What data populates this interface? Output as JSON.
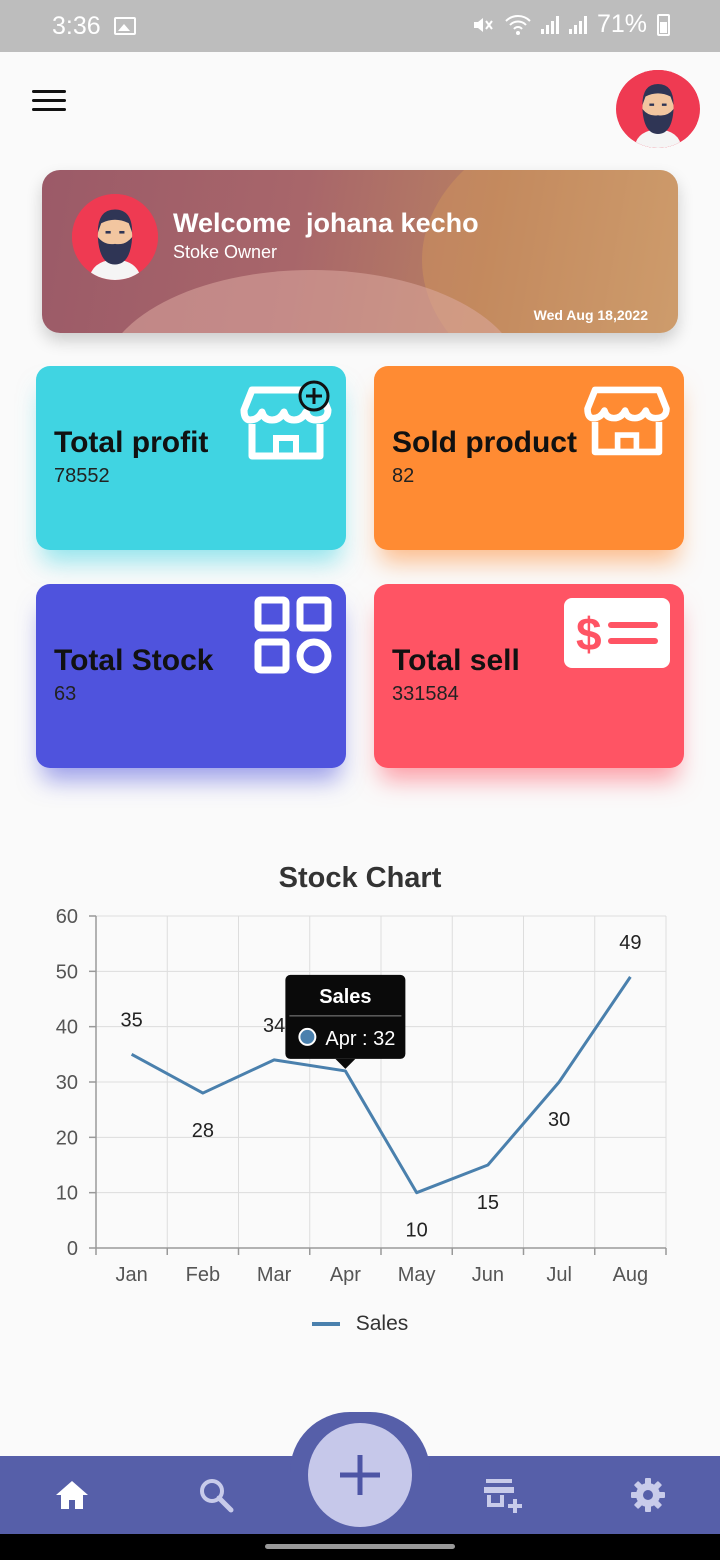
{
  "status_bar": {
    "time": "3:36",
    "battery": "71%"
  },
  "welcome": {
    "title": "Welcome  johana kecho",
    "role": "Stoke Owner",
    "date": "Wed Aug 18,2022"
  },
  "cards": [
    {
      "title": "Total profit",
      "value": "78552",
      "icon": "store-add-icon",
      "color": "#40d4e2"
    },
    {
      "title": "Sold product",
      "value": "82",
      "icon": "store-icon",
      "color": "#ff8b33"
    },
    {
      "title": "Total Stock",
      "value": "63",
      "icon": "widgets-icon",
      "color": "#4f53dd"
    },
    {
      "title": "Total sell",
      "value": "331584",
      "icon": "price-tag-icon",
      "color": "#ff5464"
    }
  ],
  "chart": {
    "title": "Stock Chart",
    "legend": "Sales"
  },
  "chart_data": {
    "type": "line",
    "title": "Stock Chart",
    "categories": [
      "Jan",
      "Feb",
      "Mar",
      "Apr",
      "May",
      "Jun",
      "Jul",
      "Aug"
    ],
    "series": [
      {
        "name": "Sales",
        "values": [
          35,
          28,
          34,
          32,
          10,
          15,
          30,
          49
        ],
        "color": "#4a80ad"
      }
    ],
    "ylim": [
      0,
      60
    ],
    "yticks": [
      0,
      10,
      20,
      30,
      40,
      50,
      60
    ],
    "grid": true,
    "legend": "bottom",
    "tooltip": {
      "title": "Sales",
      "text": "Apr : 32"
    }
  },
  "nav": {
    "items": [
      "home-icon",
      "search-icon",
      "add-icon",
      "add-store-icon",
      "settings-icon"
    ],
    "color": "#565fa9"
  }
}
